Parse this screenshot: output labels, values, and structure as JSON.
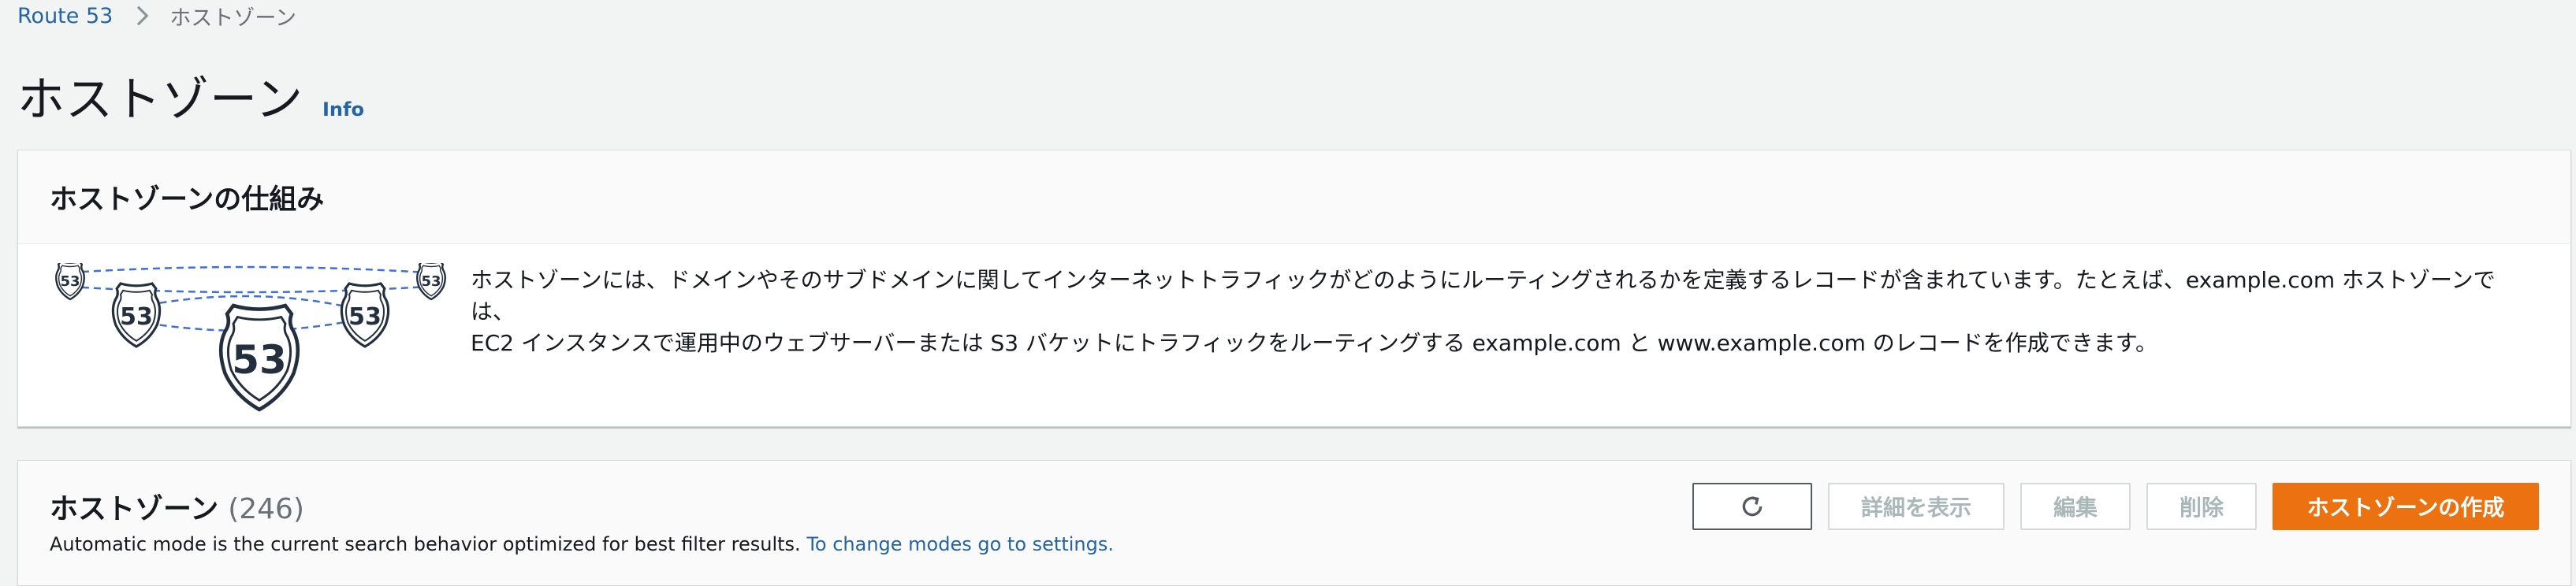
{
  "breadcrumb": {
    "root": "Route 53",
    "current": "ホストゾーン"
  },
  "page": {
    "title": "ホストゾーン",
    "info_label": "Info"
  },
  "how_it_works": {
    "title": "ホストゾーンの仕組み",
    "shield_number": "53",
    "description_line1": "ホストゾーンには、ドメインやそのサブドメインに関してインターネットトラフィックがどのようにルーティングされるかを定義するレコードが含まれています。たとえば、example.com ホストゾーンでは、",
    "description_line2": "EC2 インスタンスで運用中のウェブサーバーまたは S3 バケットにトラフィックをルーティングする example.com と www.example.com のレコードを作成できます。"
  },
  "hosted_zones": {
    "title": "ホストゾーン",
    "count": "(246)",
    "description": "Automatic mode is the current search behavior optimized for best filter results.",
    "settings_link": "To change modes go to settings.",
    "buttons": {
      "view_details": "詳細を表示",
      "edit": "編集",
      "delete": "削除",
      "create": "ホストゾーンの作成"
    }
  },
  "colors": {
    "link": "#2264a6",
    "primary_button": "#ec7211",
    "disabled_text": "#aab7b8",
    "route_dash": "#3f6fd9"
  },
  "icons": [
    "chevron-right-icon",
    "route-53-shield-icon",
    "refresh-icon"
  ]
}
